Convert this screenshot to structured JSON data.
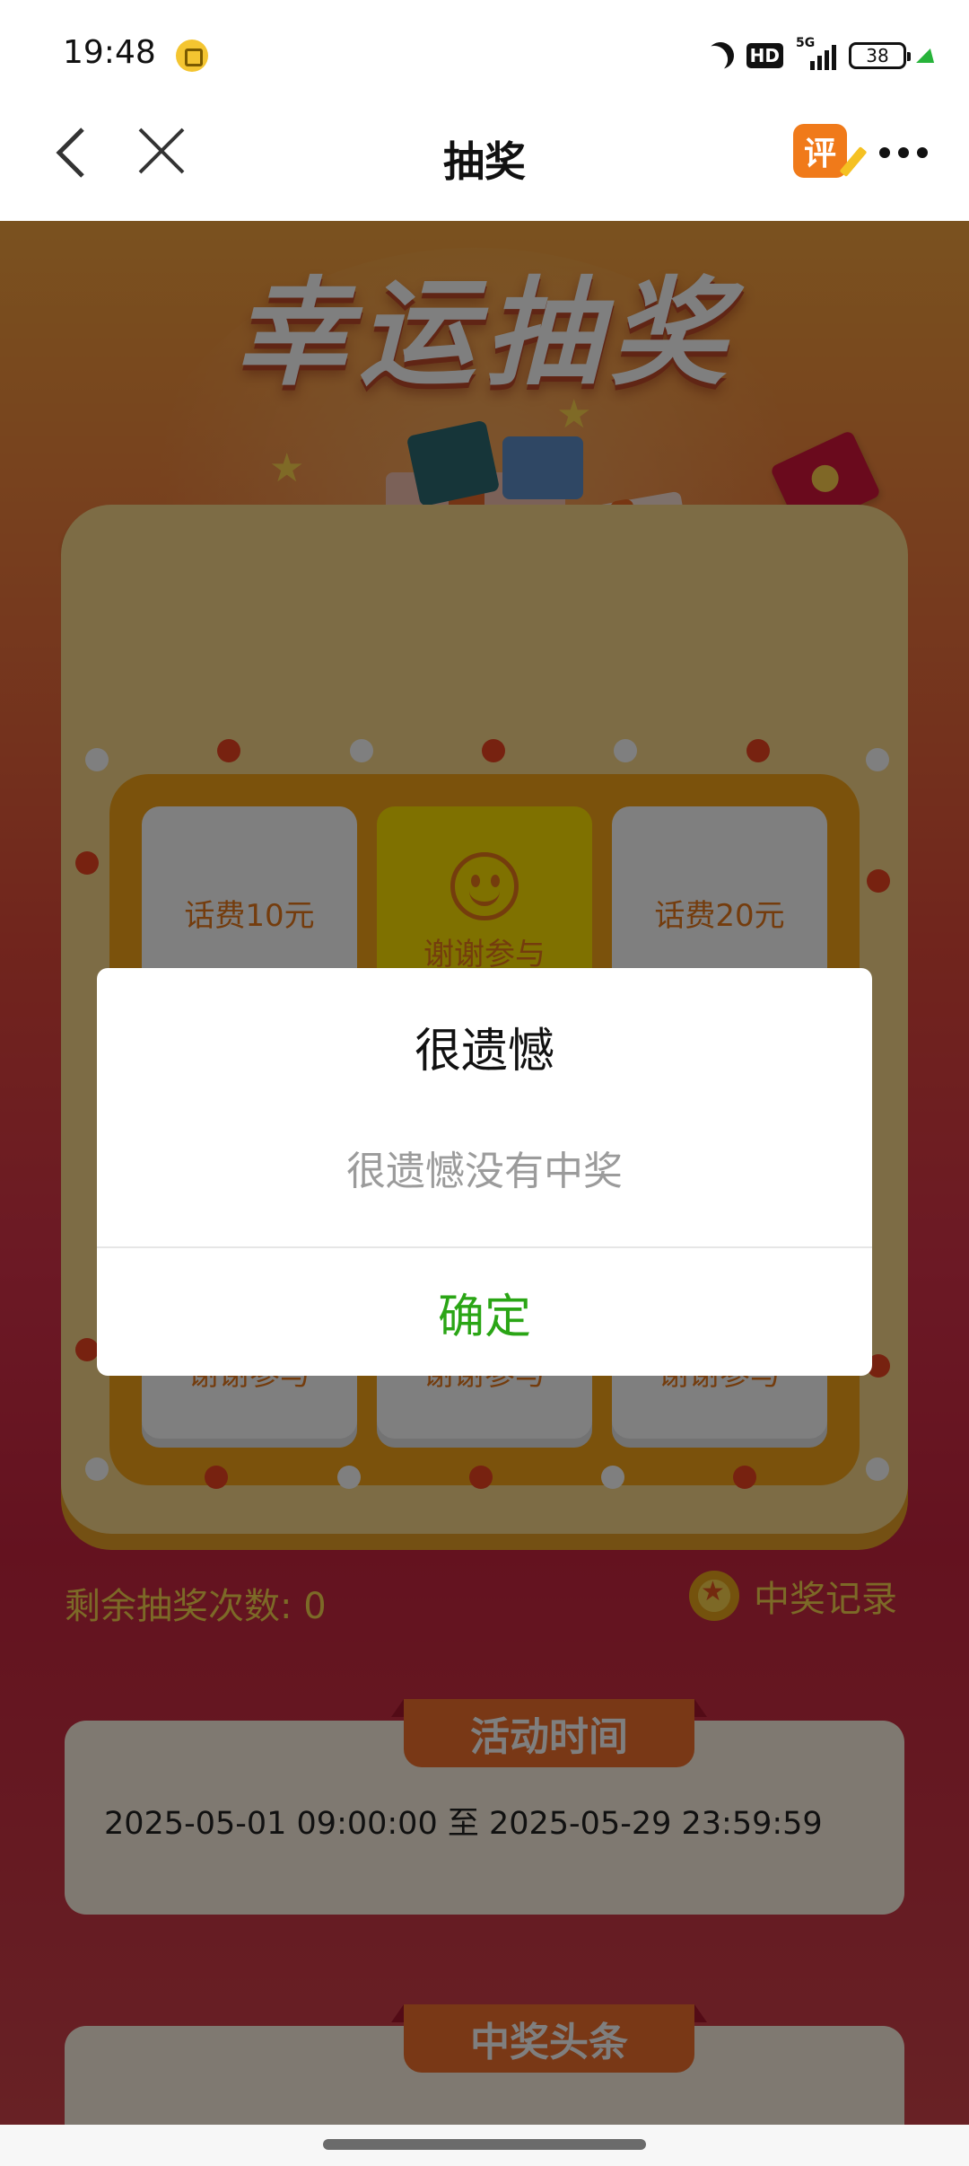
{
  "status_bar": {
    "time": "19:48",
    "network": "5G",
    "hd": "HD",
    "battery": "38"
  },
  "nav": {
    "title": "抽奖",
    "review_badge": "评"
  },
  "hero": {
    "title": "幸运抽奖"
  },
  "prizes": [
    {
      "label": "话费10元"
    },
    {
      "label": "谢谢参与",
      "active": true
    },
    {
      "label": "话费20元"
    },
    {
      "label": "谢谢参与"
    },
    {
      "label": "谢谢参与"
    },
    {
      "label": "谢谢参与"
    }
  ],
  "draw_info": {
    "remaining": "剩余抽奖次数: 0",
    "record": "中奖记录"
  },
  "activity": {
    "tab": "活动时间",
    "time_range": "2025-05-01 09:00:00 至 2025-05-29 23:59:59"
  },
  "headlines": {
    "tab": "中奖头条"
  },
  "dialog": {
    "title": "很遗憾",
    "message": "很遗憾没有中奖",
    "confirm": "确定"
  },
  "colors": {
    "accent_green": "#2aa515",
    "prize_orange": "#e8791a",
    "tab_orange": "#f3712d",
    "highlight_yellow": "#ffe300"
  }
}
